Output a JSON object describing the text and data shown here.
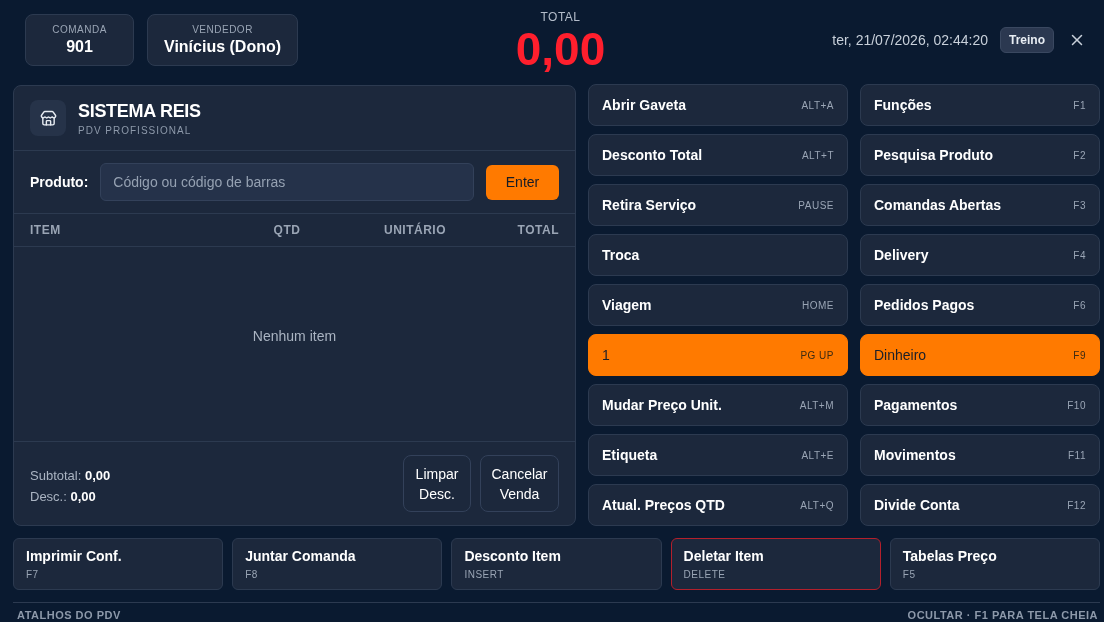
{
  "header": {
    "info_cards": [
      {
        "label": "COMANDA",
        "value": "901"
      },
      {
        "label": "VENDEDOR",
        "value": "Vinícius (Dono)"
      }
    ],
    "total": {
      "label": "TOTAL",
      "value": "0,00"
    },
    "datetime": "ter, 21/07/2026, 02:44:20",
    "mode_badge": "Treino"
  },
  "sale_panel": {
    "brand": {
      "title": "SISTEMA REIS",
      "subtitle": "PDV PROFISSIONAL"
    },
    "product_input": {
      "label": "Produto:",
      "placeholder": "Código ou código de barras",
      "button": "Enter"
    },
    "table": {
      "columns": [
        "ITEM",
        "QTD",
        "UNITÁRIO",
        "TOTAL"
      ],
      "empty_message": "Nenhum item"
    },
    "summary": [
      {
        "label": "Subtotal:",
        "value": "0,00"
      },
      {
        "label": "Desc.:",
        "value": "0,00"
      }
    ],
    "actions": [
      "Limpar Desc.",
      "Cancelar Venda"
    ]
  },
  "shortcut_grid": [
    {
      "label": "Abrir Gaveta",
      "key": "ALT+A",
      "selected": false
    },
    {
      "label": "Funções",
      "key": "F1",
      "selected": false
    },
    {
      "label": "Desconto Total",
      "key": "ALT+T",
      "selected": false
    },
    {
      "label": "Pesquisa Produto",
      "key": "F2",
      "selected": false
    },
    {
      "label": "Retira Serviço",
      "key": "PAUSE",
      "selected": false
    },
    {
      "label": "Comandas Abertas",
      "key": "F3",
      "selected": false
    },
    {
      "label": "Troca",
      "selected": false
    },
    {
      "label": "Delivery",
      "key": "F4",
      "selected": false
    },
    {
      "label": "Viagem",
      "key": "HOME",
      "selected": false
    },
    {
      "label": "Pedidos Pagos",
      "key": "F6",
      "selected": false
    },
    {
      "label": "1",
      "key": "PG UP",
      "selected": true
    },
    {
      "label": "Dinheiro",
      "key": "F9",
      "selected": true
    },
    {
      "label": "Mudar Preço Unit.",
      "key": "ALT+M",
      "selected": false
    },
    {
      "label": "Pagamentos",
      "key": "F10",
      "selected": false
    },
    {
      "label": "Etiqueta",
      "key": "ALT+E",
      "selected": false
    },
    {
      "label": "Movimentos",
      "key": "F11",
      "selected": false
    },
    {
      "label": "Atual. Preços QTD",
      "key": "ALT+Q",
      "selected": false
    },
    {
      "label": "Divide Conta",
      "key": "F12",
      "selected": false
    }
  ],
  "bottom_actions": [
    {
      "label": "Imprimir Conf.",
      "key": "F7",
      "kind": "normal"
    },
    {
      "label": "Juntar Comanda",
      "key": "F8",
      "kind": "normal"
    },
    {
      "label": "Desconto Item",
      "key": "INSERT",
      "kind": "normal"
    },
    {
      "label": "Deletar Item",
      "key": "DELETE",
      "kind": "danger"
    },
    {
      "label": "Tabelas Preço",
      "key": "F5",
      "kind": "normal"
    }
  ],
  "footer": {
    "title": "ATALHOS DO PDV",
    "toggle": "OCULTAR · F1 PARA TELA CHEIA"
  }
}
